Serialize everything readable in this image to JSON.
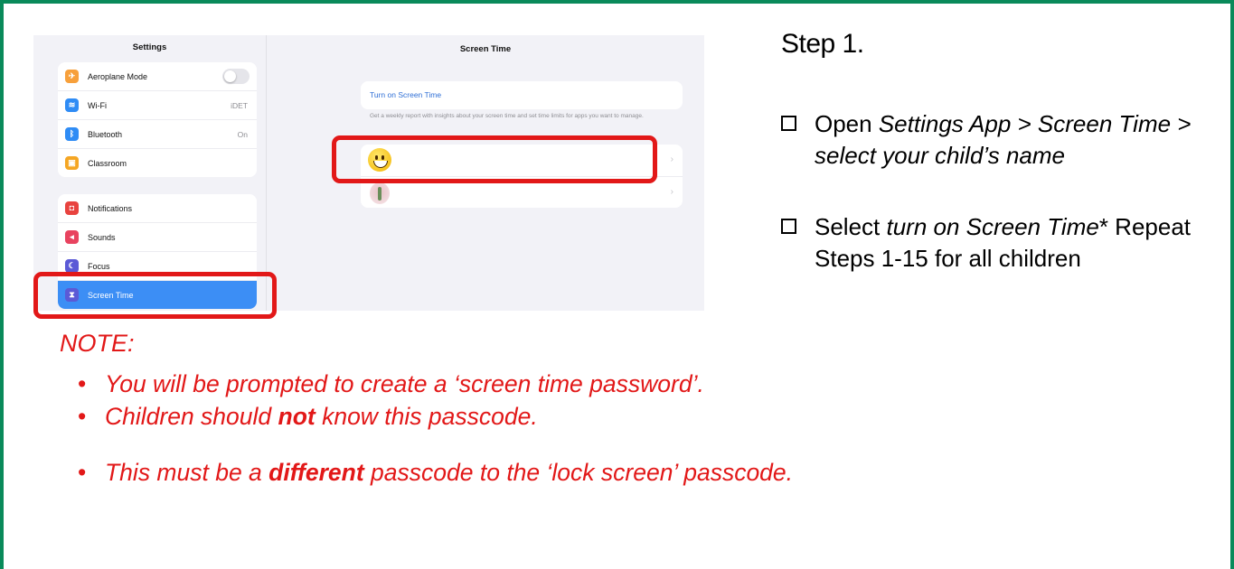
{
  "ipad": {
    "settings_title": "Settings",
    "settings_group1": [
      {
        "label": "Aeroplane Mode",
        "icon": "airplane-icon",
        "color": "#f7a03b",
        "value": "",
        "toggle": true
      },
      {
        "label": "Wi-Fi",
        "icon": "wifi-icon",
        "color": "#2f8cf5",
        "value": "iDET"
      },
      {
        "label": "Bluetooth",
        "icon": "bluetooth-icon",
        "color": "#2f8cf5",
        "value": "On"
      },
      {
        "label": "Classroom",
        "icon": "classroom-icon",
        "color": "#f5a623",
        "value": ""
      }
    ],
    "settings_group2": [
      {
        "label": "Notifications",
        "icon": "notifications-icon",
        "color": "#e8433f"
      },
      {
        "label": "Sounds",
        "icon": "sounds-icon",
        "color": "#e8435f"
      },
      {
        "label": "Focus",
        "icon": "focus-icon",
        "color": "#5b5ad6"
      },
      {
        "label": "Screen Time",
        "icon": "hourglass-icon",
        "color": "#5b5ad6",
        "selected": true
      }
    ],
    "main_title": "Screen Time",
    "turn_on_label": "Turn on Screen Time",
    "description": "Get a weekly report with insights about your screen time and set time limits for apps you want to manage."
  },
  "instructions": {
    "step_title": "Step 1.",
    "item1": {
      "prefix": "Open ",
      "italic": "Settings App > Screen Time > select your child’s name"
    },
    "item2": {
      "prefix": "Select ",
      "italic": "turn on Screen Time",
      "suffix": "* Repeat Steps 1-15 for all children"
    }
  },
  "note": {
    "title": "NOTE:",
    "bullet1": "You will be prompted to create a ‘screen time password’.",
    "bullet2_a": "Children should ",
    "bullet2_b": "not",
    "bullet2_c": " know this passcode.",
    "bullet3_a": "This must be a ",
    "bullet3_b": "different",
    "bullet3_c": " passcode to the ‘lock screen’ passcode.",
    "bullet_symbol": "•"
  },
  "colors": {
    "frame": "#0a8a5a",
    "highlight": "#e21818",
    "note_text": "#e21818"
  }
}
